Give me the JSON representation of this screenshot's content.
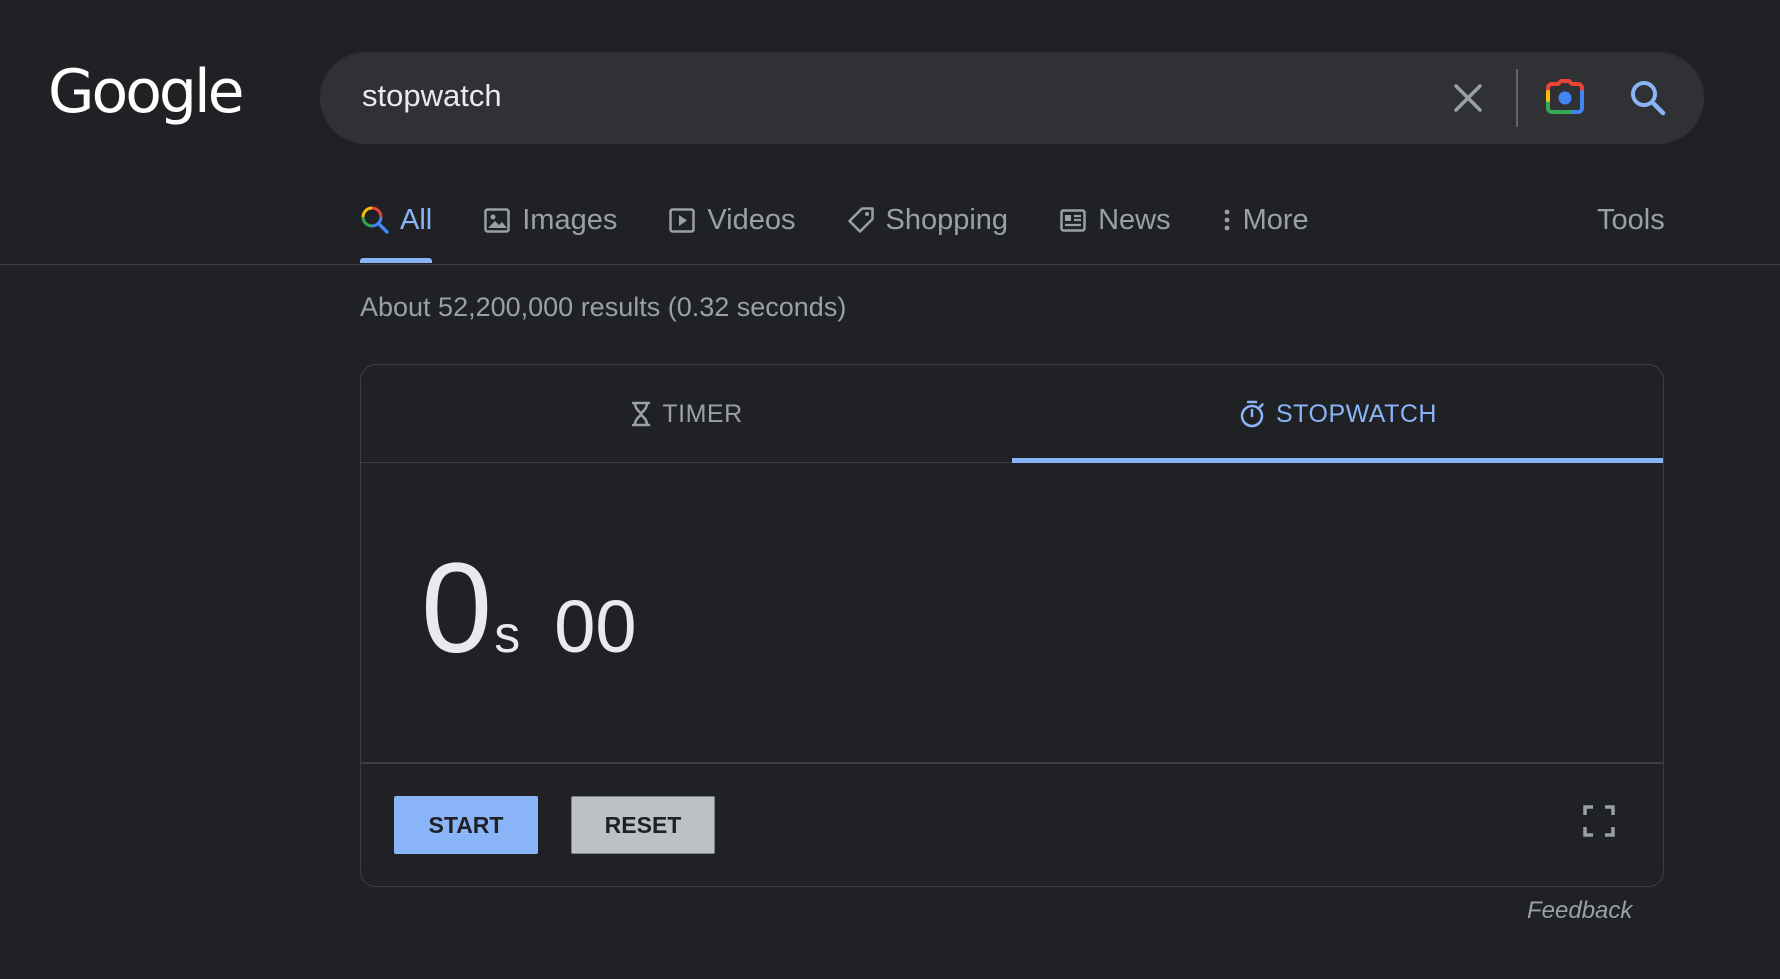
{
  "header": {
    "logo_text": "Google",
    "search": {
      "query": "stopwatch",
      "clear_icon": "close-icon",
      "lens_icon": "camera-icon",
      "search_icon": "search-icon"
    }
  },
  "nav": {
    "tabs": [
      {
        "label": "All",
        "icon": "search-icon",
        "active": true
      },
      {
        "label": "Images",
        "icon": "image-icon"
      },
      {
        "label": "Videos",
        "icon": "play-icon"
      },
      {
        "label": "Shopping",
        "icon": "tag-icon"
      },
      {
        "label": "News",
        "icon": "newspaper-icon"
      },
      {
        "label": "More",
        "icon": "more-vertical-icon"
      }
    ],
    "tools_label": "Tools"
  },
  "result_stats": "About 52,200,000 results (0.32 seconds)",
  "stopwatch": {
    "tabs": {
      "timer_label": "TIMER",
      "stopwatch_label": "STOPWATCH",
      "active": "STOPWATCH"
    },
    "display": {
      "seconds": "0",
      "seconds_unit": "s",
      "centiseconds": "00"
    },
    "buttons": {
      "start_label": "START",
      "reset_label": "RESET"
    },
    "fullscreen_icon": "fullscreen-icon"
  },
  "feedback_label": "Feedback",
  "colors": {
    "background": "#202124",
    "accent": "#8ab4f8",
    "muted_text": "#9aa0a6",
    "border": "#3c4043"
  }
}
